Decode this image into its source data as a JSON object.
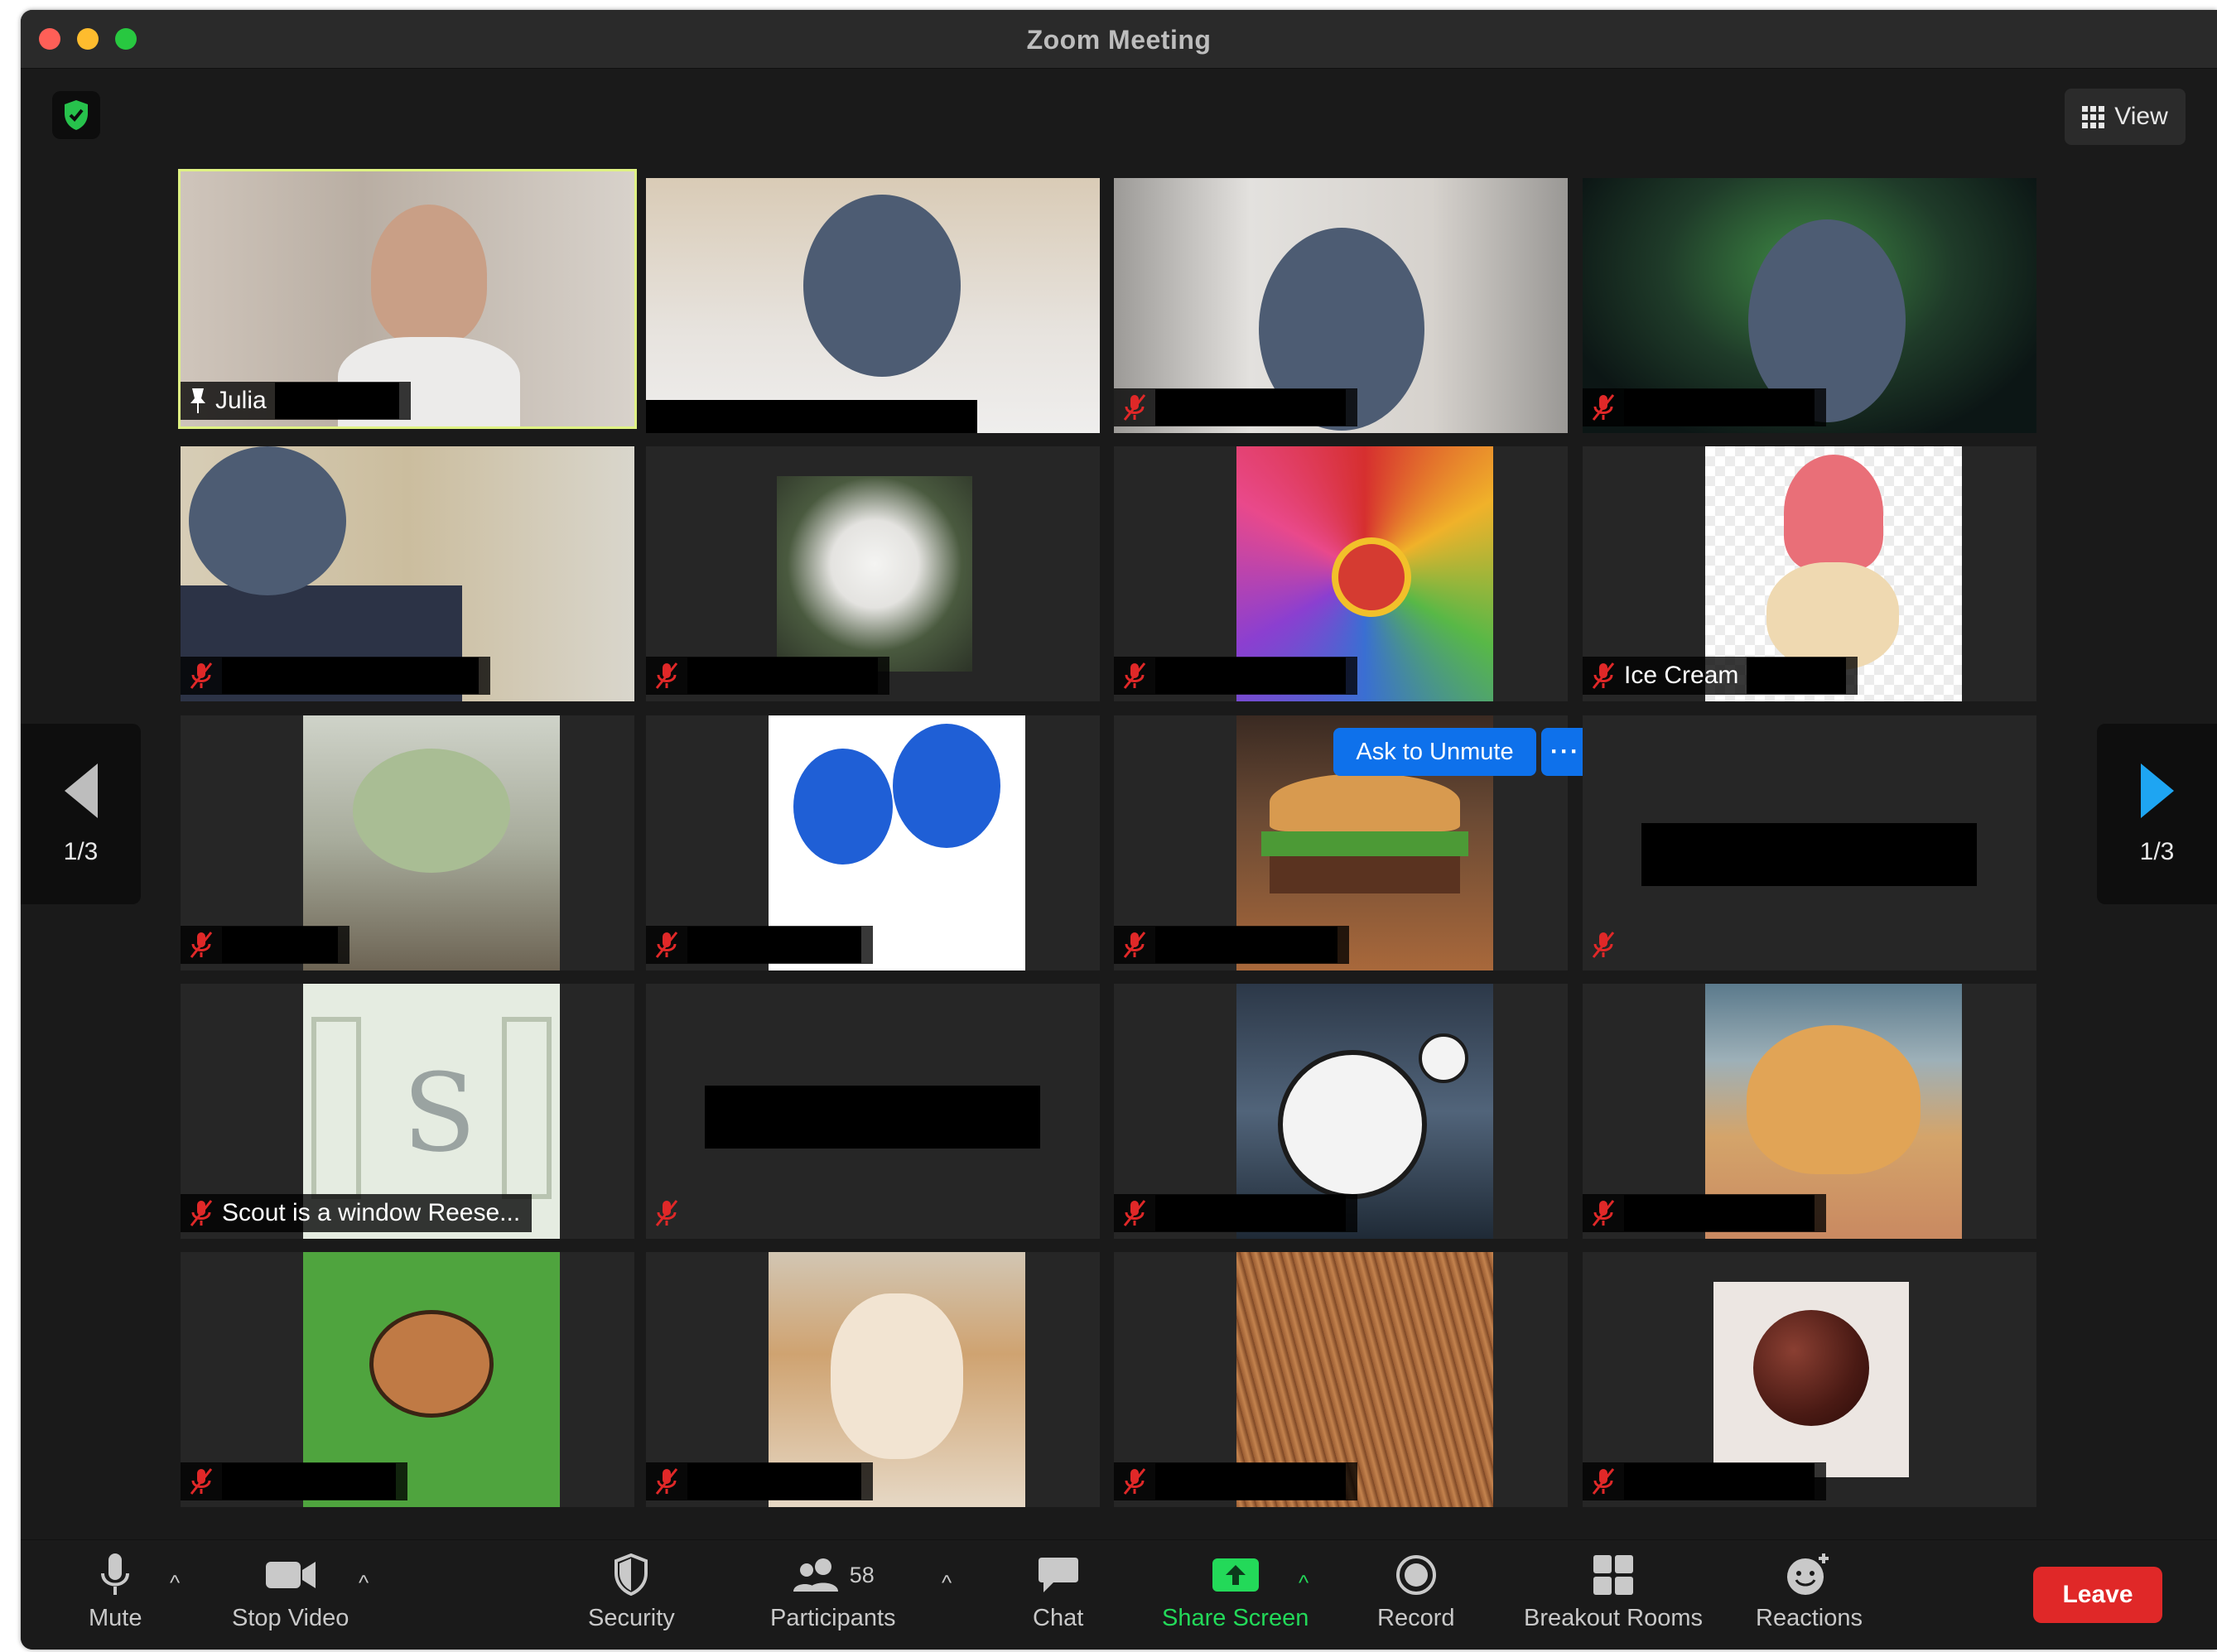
{
  "window": {
    "title": "Zoom Meeting"
  },
  "top_bar": {
    "view_label": "View"
  },
  "nav": {
    "page_left": "1/3",
    "page_right": "1/3"
  },
  "tile_labels": {
    "julia": "Julia",
    "ice_cream": "Ice Cream",
    "scout": "Scout is a window Reese..."
  },
  "actions": {
    "ask_to_unmute": "Ask to Unmute",
    "more": "···"
  },
  "toolbar": {
    "mute": "Mute",
    "stop_video": "Stop Video",
    "security": "Security",
    "participants": "Participants",
    "participants_count": "58",
    "chat": "Chat",
    "share_screen": "Share Screen",
    "record": "Record",
    "breakout_rooms": "Breakout Rooms",
    "reactions": "Reactions",
    "leave": "Leave"
  },
  "colors": {
    "accent_blue": "#0e71eb",
    "share_green": "#23d959",
    "leave_red": "#e02828",
    "active_speaker": "#dff283",
    "mic_muted": "#e02828"
  }
}
